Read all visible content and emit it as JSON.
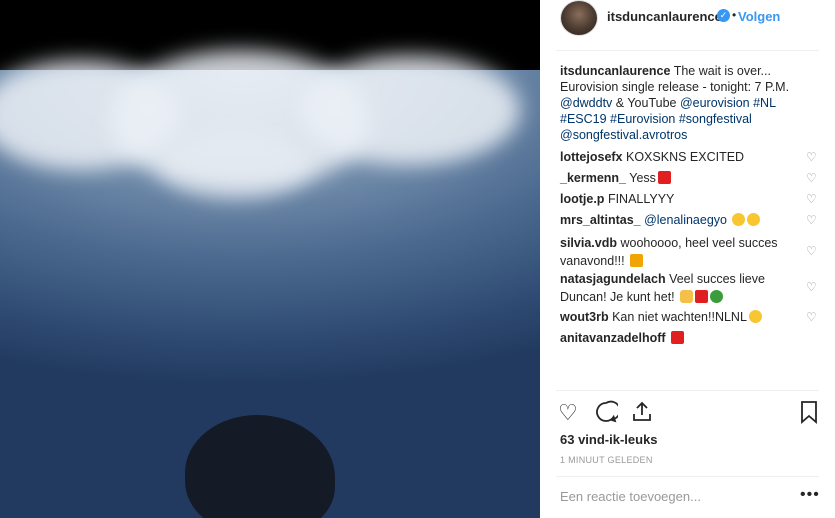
{
  "post": {
    "username": "itsduncanlaurence",
    "follow_label": "Volgen",
    "caption_user": "itsduncanlaurence",
    "caption_text_1": "The wait is over... Eurovision single release - tonight: 7 P.M.",
    "caption_mention_1": "@dwddtv",
    "caption_and": " & YouTube ",
    "caption_mention_2": "@eurovision",
    "caption_tag_1": "#NL",
    "caption_tag_2": "#ESC19",
    "caption_tag_3": "#Eurovision",
    "caption_tag_4": "#songfestival",
    "caption_mention_3": "@songfestival.avrotros",
    "likes": "63 vind-ik-leuks",
    "time": "1 MINUUT GELEDEN",
    "reply_placeholder": "Een reactie toevoegen...",
    "more": "•••"
  },
  "comments": [
    {
      "user": "lottejosefx",
      "text": "KOXSKNS EXCITED"
    },
    {
      "user": "_kermenn_",
      "text": "Yess"
    },
    {
      "user": "lootje.p",
      "text": "FINALLYYY"
    },
    {
      "user": "mrs_altintas_",
      "text": "@lenalinaegyo"
    },
    {
      "user": "silvia.vdb",
      "text": "woohoooo, heel veel succes vanavond!!!"
    },
    {
      "user": "natasjagundelach",
      "text": "Veel succes lieve Duncan! Je kunt het!"
    },
    {
      "user": "wout3rb",
      "text": "Kan niet wachten!!NLNL"
    },
    {
      "user": "anitavanzadelhoff",
      "text": ""
    }
  ],
  "icons": {
    "like": "heart-icon",
    "comment": "comment-icon",
    "share": "share-icon",
    "save": "bookmark-icon"
  },
  "colors": {
    "link": "#003569",
    "accent": "#3897f0",
    "muted": "#999999"
  }
}
